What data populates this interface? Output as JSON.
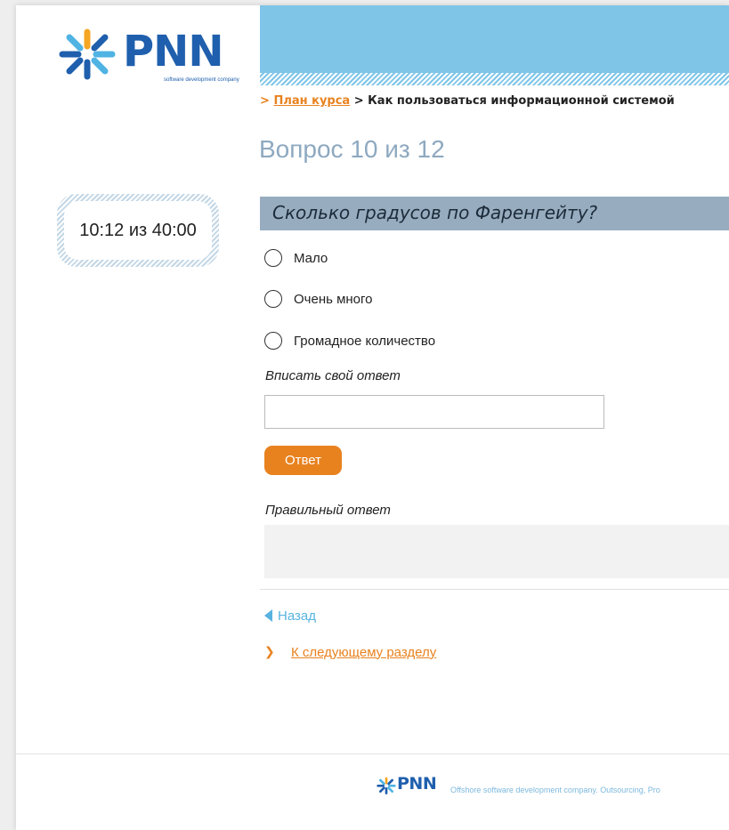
{
  "logo": {
    "text": "PNN",
    "tagline": "software development company"
  },
  "breadcrumb": {
    "prefix": ">",
    "link": "План курса",
    "separator": ">",
    "current": "Как пользоваться информационной системой"
  },
  "question_number": "Вопрос 10 из 12",
  "timer": "10:12 из 40:00",
  "question": "Сколько градусов по Фаренгейту?",
  "options": [
    {
      "label": "Мало"
    },
    {
      "label": "Очень много"
    },
    {
      "label": "Громадное количество"
    }
  ],
  "custom_answer": {
    "label": "Вписать свой ответ",
    "value": ""
  },
  "answer_button": "Ответ",
  "correct_answer": {
    "label": "Правильный ответ",
    "value": ""
  },
  "nav": {
    "back": "Назад",
    "next": "К следующему разделу"
  },
  "footer": {
    "logo_text": "PNN",
    "tagline": "Offshore software development company. Outsourcing, Pro"
  },
  "colors": {
    "banner": "#7ec5e8",
    "accent_orange": "#e8821f",
    "question_bar": "#97adbf",
    "logo_blue": "#1f5fad",
    "link_blue": "#58b3e0"
  },
  "icons": {
    "logo_mark": "pnn-burst-logo-icon",
    "back": "back-arrow-icon",
    "next": "chevron-right-icon",
    "radio": "radio-icon"
  }
}
